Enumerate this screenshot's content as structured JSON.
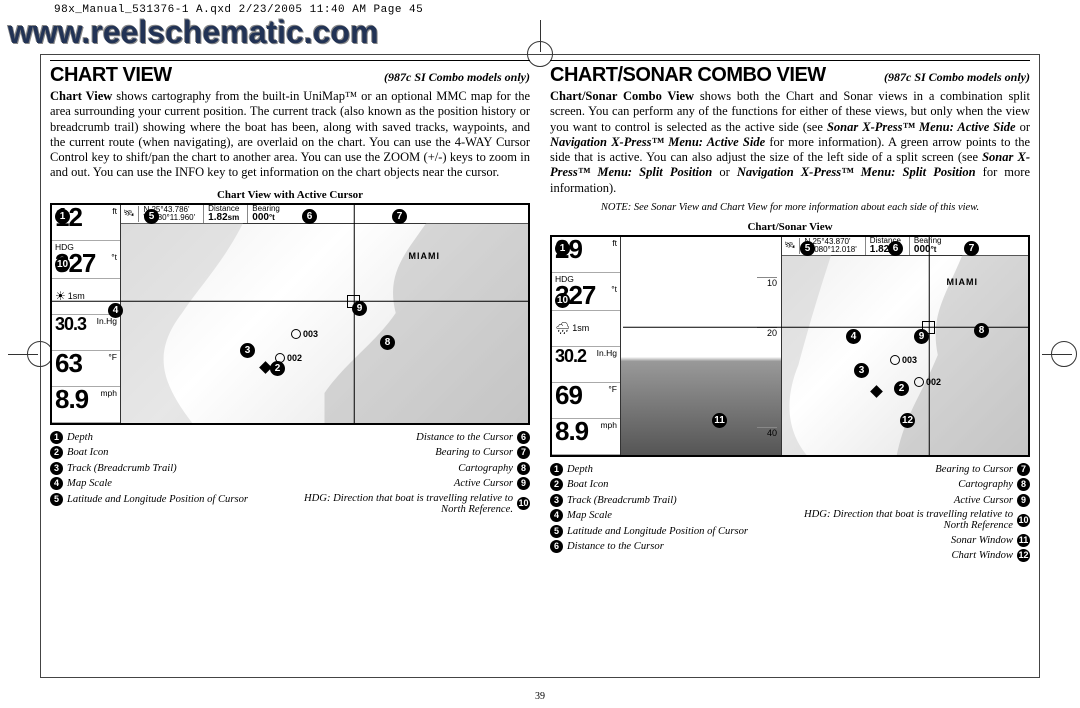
{
  "print_header": "98x_Manual_531376-1 A.qxd  2/23/2005  11:40 AM  Page 45",
  "watermark": "www.reelschematic.com",
  "page_number": "39",
  "left": {
    "title": "CHART VIEW",
    "subtitle": "(987c SI Combo models only)",
    "body": "<b>Chart View</b> shows cartography from the built-in UniMap™ or an optional MMC map for the area surrounding your current position. The current track (also known as the position history or breadcrumb trail) showing where the boat has been, along with saved tracks, waypoints, and the current route (when navigating), are overlaid on the chart. You can use the 4-WAY Cursor Control key to shift/pan the chart to another area. You can use the ZOOM (+/-) keys to zoom in and out. You can use the INFO key to get information on the chart objects near the cursor.",
    "fig_title": "Chart View with Active Cursor",
    "readouts": {
      "depth": "12",
      "depth_u": "ft",
      "hdg": "327",
      "hdg_u": "°t",
      "hdg_lbl": "HDG",
      "baro": "30.3",
      "baro_u": "In.Hg",
      "temp": "63",
      "temp_u": "°F",
      "speed": "8.9",
      "speed_u": "mph",
      "scale": "1sm"
    },
    "top": {
      "lat": "N 25°43.786'",
      "lon": "W 080°11.960'",
      "dist_lbl": "Distance",
      "dist_val": "1.82",
      "dist_u": "sm",
      "brg_lbl": "Bearing",
      "brg_val": "000",
      "brg_u": "°t"
    },
    "city": "MIAMI",
    "wps": [
      "003",
      "002"
    ],
    "legend_left": [
      {
        "n": "1",
        "t": "Depth"
      },
      {
        "n": "2",
        "t": "Boat Icon"
      },
      {
        "n": "3",
        "t": "Track (Breadcrumb Trail)"
      },
      {
        "n": "4",
        "t": "Map Scale"
      },
      {
        "n": "5",
        "t": "Latitude and Longitude Position of Cursor"
      }
    ],
    "legend_right": [
      {
        "n": "6",
        "t": "Distance to the Cursor"
      },
      {
        "n": "7",
        "t": "Bearing to Cursor"
      },
      {
        "n": "8",
        "t": "Cartography"
      },
      {
        "n": "9",
        "t": "Active Cursor"
      },
      {
        "n": "10",
        "t": "HDG: Direction that boat is travelling relative to North Reference."
      }
    ]
  },
  "right": {
    "title": "CHART/SONAR COMBO VIEW",
    "subtitle": "(987c SI Combo models only)",
    "body": "<b>Chart/Sonar Combo View</b> shows both the Chart and Sonar views in a combination split screen. You can perform any of the functions for either of these views, but only when the view you want to control is selected as the active side (see <b><i>Sonar X-Press™ Menu: Active Side</i></b> or <b><i>Navigation X-Press™ Menu: Active Side</i></b> for more information). A green arrow points to the side that is active. You can also adjust the size of the left side of a split screen (see <b><i>Sonar X-Press™ Menu: Split Position</i></b> or <b><i>Navigation X-Press™ Menu: Split Position</i></b> for more information).",
    "note": "NOTE: See Sonar View and Chart View for more information about each side of this view.",
    "fig_title": "Chart/Sonar View",
    "readouts": {
      "depth": "29",
      "depth_u": "ft",
      "hdg": "327",
      "hdg_u": "°t",
      "hdg_lbl": "HDG",
      "baro": "30.2",
      "baro_u": "In.Hg",
      "temp": "69",
      "temp_u": "°F",
      "speed": "8.9",
      "speed_u": "mph",
      "scale": "1sm"
    },
    "sonar": {
      "d1": "10",
      "d2": "20",
      "d3": "40"
    },
    "top": {
      "lat": "N 25°43.870'",
      "lon": "W 080°12.018'",
      "dist_lbl": "Distance",
      "dist_val": "1.82",
      "dist_u": "sm",
      "brg_lbl": "Bearing",
      "brg_val": "000",
      "brg_u": "°t"
    },
    "city": "MIAMI",
    "wps": [
      "003",
      "002"
    ],
    "legend_left": [
      {
        "n": "1",
        "t": "Depth"
      },
      {
        "n": "2",
        "t": "Boat Icon"
      },
      {
        "n": "3",
        "t": "Track (Breadcrumb Trail)"
      },
      {
        "n": "4",
        "t": "Map Scale"
      },
      {
        "n": "5",
        "t": "Latitude and Longitude Position of Cursor"
      },
      {
        "n": "6",
        "t": "Distance to the Cursor"
      }
    ],
    "legend_right": [
      {
        "n": "7",
        "t": "Bearing to Cursor"
      },
      {
        "n": "8",
        "t": "Cartography"
      },
      {
        "n": "9",
        "t": "Active Cursor"
      },
      {
        "n": "10",
        "t": "HDG: Direction that boat is travelling relative to North Reference"
      },
      {
        "n": "11",
        "t": "Sonar Window"
      },
      {
        "n": "12",
        "t": "Chart Window"
      }
    ]
  }
}
